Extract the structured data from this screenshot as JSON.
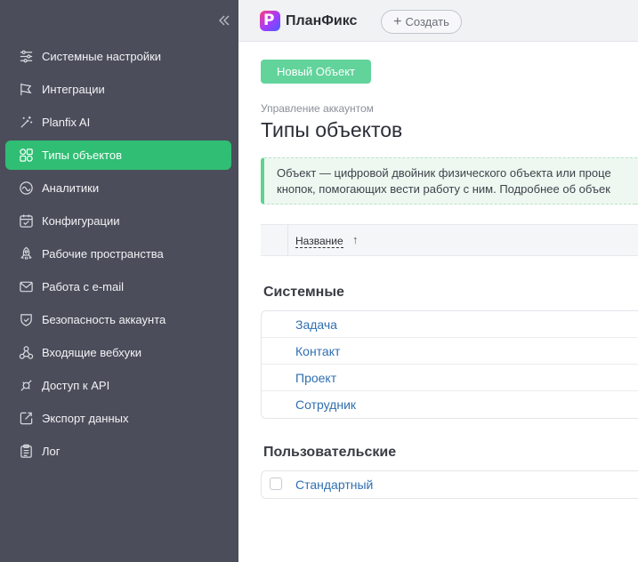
{
  "sidebar": {
    "collapse_icon": "double-chevron-left-icon",
    "items": [
      {
        "label": "Системные настройки",
        "icon": "sliders-icon",
        "active": false
      },
      {
        "label": "Интеграции",
        "icon": "flag-icon",
        "active": false
      },
      {
        "label": "Planfix AI",
        "icon": "magic-wand-icon",
        "active": false
      },
      {
        "label": "Типы объектов",
        "icon": "shapes-icon",
        "active": true
      },
      {
        "label": "Аналитики",
        "icon": "wave-circle-icon",
        "active": false
      },
      {
        "label": "Конфигурации",
        "icon": "calendar-box-icon",
        "active": false
      },
      {
        "label": "Рабочие пространства",
        "icon": "rocket-icon",
        "active": false
      },
      {
        "label": "Работа с e-mail",
        "icon": "mail-icon",
        "active": false
      },
      {
        "label": "Безопасность аккаунта",
        "icon": "shield-check-icon",
        "active": false
      },
      {
        "label": "Входящие вебхуки",
        "icon": "webhook-icon",
        "active": false
      },
      {
        "label": "Доступ к API",
        "icon": "api-icon",
        "active": false
      },
      {
        "label": "Экспорт данных",
        "icon": "export-icon",
        "active": false
      },
      {
        "label": "Лог",
        "icon": "clipboard-icon",
        "active": false
      }
    ]
  },
  "topbar": {
    "logo_text": "ПланФикс",
    "create_label": "Создать"
  },
  "main": {
    "new_object_label": "Новый Объект",
    "breadcrumb": "Управление аккаунтом",
    "title": "Типы объектов",
    "info_line1": "Объект — цифровой двойник физического объекта или проце",
    "info_line2": "кнопок, помогающих вести работу с ним. Подробнее об объек",
    "table_header": {
      "name": "Название",
      "sort": "↑"
    },
    "groups": [
      {
        "title": "Системные",
        "items": [
          "Задача",
          "Контакт",
          "Проект",
          "Сотрудник"
        ]
      },
      {
        "title": "Пользовательские",
        "items": [
          "Стандартный"
        ]
      }
    ]
  },
  "colors": {
    "sidebar_bg": "#4b4d5a",
    "accent_green": "#2fbe73",
    "link_blue": "#2f6fb0"
  }
}
